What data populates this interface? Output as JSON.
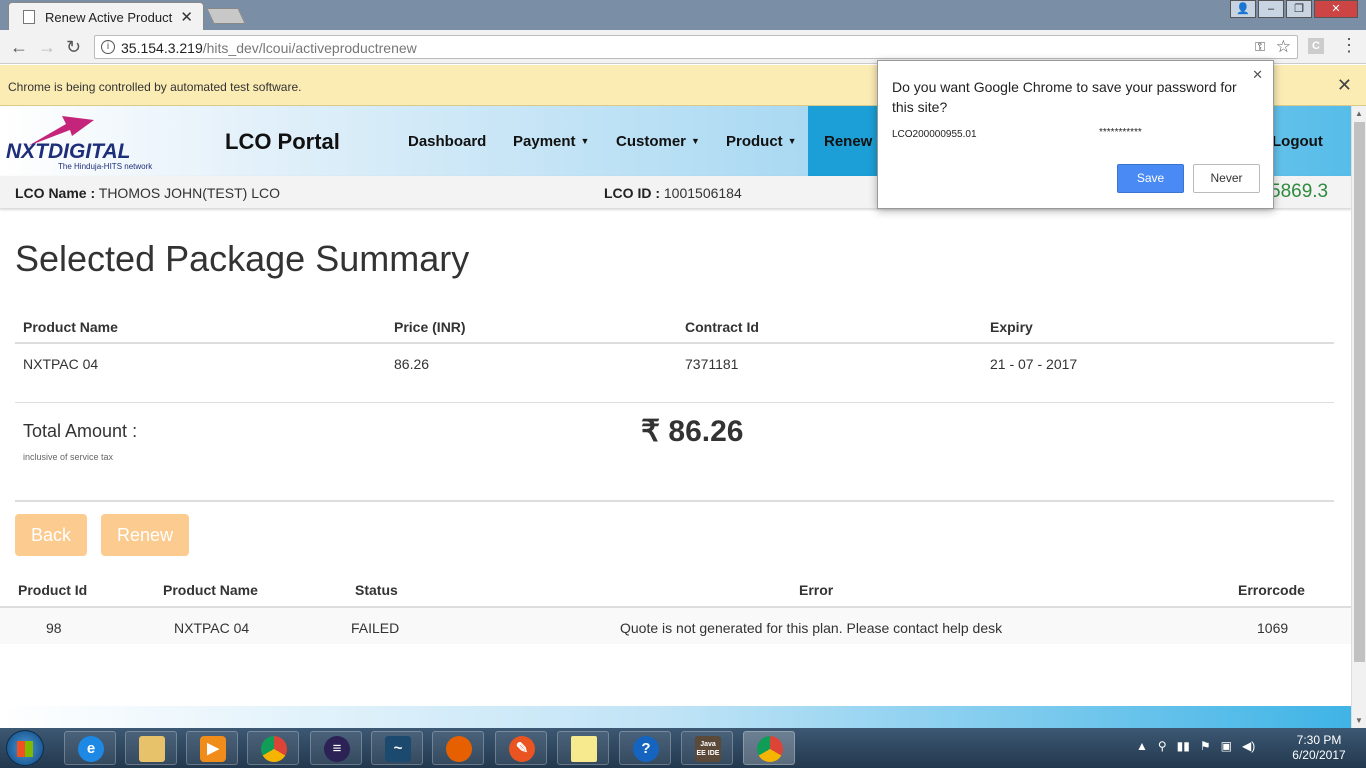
{
  "browser": {
    "tab_title": "Renew Active Product",
    "url_host": "35.154.3.219",
    "url_path": "/hits_dev/lcoui/activeproductrenew",
    "infobar_text": "Chrome is being controlled by automated test software."
  },
  "password_prompt": {
    "question": "Do you want Google Chrome to save your password for this site?",
    "username": "LCO200000955.01",
    "password": "***********",
    "save_label": "Save",
    "never_label": "Never"
  },
  "header": {
    "logo_text": "NXTDIGITAL",
    "logo_tagline": "The Hinduja-HITS network",
    "portal_title": "LCO Portal",
    "nav": [
      {
        "label": "Dashboard"
      },
      {
        "label": "Payment"
      },
      {
        "label": "Customer"
      },
      {
        "label": "Product"
      },
      {
        "label": "Renew"
      },
      {
        "label": "Logout"
      }
    ],
    "active_color": "#1b9fd6"
  },
  "subbar": {
    "lco_name_label": "LCO Name :",
    "lco_name": "THOMOS JOHN(TEST) LCO",
    "lco_id_label": "LCO ID :",
    "lco_id": "1001506184",
    "balance": "5869.3"
  },
  "summary": {
    "title": "Selected Package Summary",
    "columns": [
      "Product Name",
      "Price (INR)",
      "Contract Id",
      "Expiry"
    ],
    "rows": [
      [
        "NXTPAC 04",
        "86.26",
        "7371181",
        "21 - 07 - 2017"
      ]
    ],
    "total_label": "Total Amount :",
    "total_note": "inclusive of service tax",
    "total_amount": "₹ 86.26"
  },
  "actions": {
    "back_label": "Back",
    "renew_label": "Renew",
    "button_color": "#fbcb8f"
  },
  "result": {
    "columns": [
      "Product Id",
      "Product Name",
      "Status",
      "Error",
      "Errorcode"
    ],
    "rows": [
      [
        "98",
        "NXTPAC 04",
        "FAILED",
        "Quote is not generated for this plan. Please contact help desk",
        "1069"
      ]
    ]
  },
  "taskbar": {
    "apps": [
      "ie-icon",
      "explorer-icon",
      "media-player-icon",
      "chrome-icon",
      "eclipse-icon",
      "mysql-icon",
      "firefox-icon",
      "tool-icon",
      "sticky-notes-icon",
      "help-icon",
      "java-ee-ide-icon",
      "chrome-icon"
    ],
    "java_label": "Java EE IDE",
    "time": "7:30 PM",
    "date": "6/20/2017"
  }
}
